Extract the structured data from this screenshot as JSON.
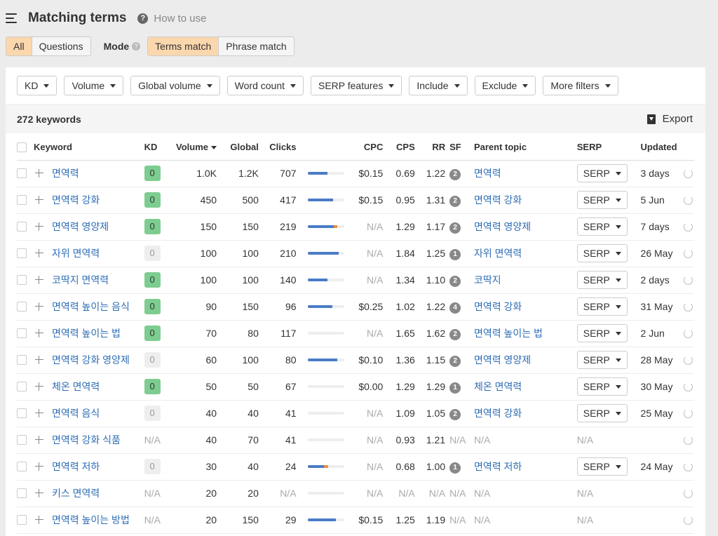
{
  "header": {
    "title": "Matching terms",
    "help_label": "How to use",
    "menu_icon": "hamburger-menu-icon"
  },
  "tabs": {
    "all": "All",
    "questions": "Questions",
    "mode_label": "Mode",
    "terms_match": "Terms match",
    "phrase_match": "Phrase match"
  },
  "filters": [
    "KD",
    "Volume",
    "Global volume",
    "Word count",
    "SERP features",
    "Include",
    "Exclude",
    "More filters"
  ],
  "summary": {
    "count_label": "272 keywords",
    "export_label": "Export"
  },
  "columns": {
    "keyword": "Keyword",
    "kd": "KD",
    "volume": "Volume",
    "global": "Global",
    "clicks": "Clicks",
    "cpc": "CPC",
    "cps": "CPS",
    "rr": "RR",
    "sf": "SF",
    "parent": "Parent topic",
    "serp": "SERP",
    "updated": "Updated"
  },
  "serp_button": "SERP",
  "colors": {
    "accent": "#fbd7ad",
    "link": "#2e6db4",
    "kd_green": "#7ccd8f",
    "bar_blue": "#4a7cc7",
    "bar_orange": "#e8903e"
  },
  "rows": [
    {
      "keyword": "면역력",
      "kd": "0",
      "kd_color": "green",
      "volume": "1.0K",
      "global": "1.2K",
      "clicks": "707",
      "bar_blue": 0.55,
      "bar_orange": 0,
      "cpc": "$0.15",
      "cps": "0.69",
      "rr": "1.22",
      "sf": "2",
      "parent": "면역력",
      "serp": true,
      "updated": "3 days"
    },
    {
      "keyword": "면역력 강화",
      "kd": "0",
      "kd_color": "green",
      "volume": "450",
      "global": "500",
      "clicks": "417",
      "bar_blue": 0.7,
      "bar_orange": 0,
      "cpc": "$0.15",
      "cps": "0.95",
      "rr": "1.31",
      "sf": "2",
      "parent": "면역력 강화",
      "serp": true,
      "updated": "5 Jun"
    },
    {
      "keyword": "면역력 영양제",
      "kd": "0",
      "kd_color": "green",
      "volume": "150",
      "global": "150",
      "clicks": "219",
      "bar_blue": 0.72,
      "bar_orange": 0.1,
      "cpc": "N/A",
      "cps": "1.29",
      "rr": "1.17",
      "sf": "2",
      "parent": "면역력 영양제",
      "serp": true,
      "updated": "7 days"
    },
    {
      "keyword": "자위 면역력",
      "kd": "0",
      "kd_color": "gray",
      "volume": "100",
      "global": "100",
      "clicks": "210",
      "bar_blue": 0.85,
      "bar_orange": 0,
      "cpc": "N/A",
      "cps": "1.84",
      "rr": "1.25",
      "sf": "1",
      "parent": "자위 면역력",
      "serp": true,
      "updated": "26 May"
    },
    {
      "keyword": "코딱지 면역력",
      "kd": "0",
      "kd_color": "green",
      "volume": "100",
      "global": "100",
      "clicks": "140",
      "bar_blue": 0.55,
      "bar_orange": 0,
      "cpc": "N/A",
      "cps": "1.34",
      "rr": "1.10",
      "sf": "2",
      "parent": "코딱지",
      "serp": true,
      "updated": "2 days"
    },
    {
      "keyword": "면역력 높이는 음식",
      "kd": "0",
      "kd_color": "green",
      "volume": "90",
      "global": "150",
      "clicks": "96",
      "bar_blue": 0.68,
      "bar_orange": 0,
      "cpc": "$0.25",
      "cps": "1.02",
      "rr": "1.22",
      "sf": "4",
      "parent": "면역력 강화",
      "serp": true,
      "updated": "31 May"
    },
    {
      "keyword": "면역력 높이는 법",
      "kd": "0",
      "kd_color": "green",
      "volume": "70",
      "global": "80",
      "clicks": "117",
      "bar_blue": 0,
      "bar_orange": 0,
      "cpc": "N/A",
      "cps": "1.65",
      "rr": "1.62",
      "sf": "2",
      "parent": "면역력 높이는 법",
      "serp": true,
      "updated": "2 Jun"
    },
    {
      "keyword": "면역력 강화 영양제",
      "kd": "0",
      "kd_color": "gray",
      "volume": "60",
      "global": "100",
      "clicks": "80",
      "bar_blue": 0.82,
      "bar_orange": 0,
      "cpc": "$0.10",
      "cps": "1.36",
      "rr": "1.15",
      "sf": "2",
      "parent": "면역력 영양제",
      "serp": true,
      "updated": "28 May"
    },
    {
      "keyword": "체온 면역력",
      "kd": "0",
      "kd_color": "green",
      "volume": "50",
      "global": "50",
      "clicks": "67",
      "bar_blue": 0,
      "bar_orange": 0,
      "cpc": "$0.00",
      "cps": "1.29",
      "rr": "1.29",
      "sf": "1",
      "parent": "체온 면역력",
      "serp": true,
      "updated": "30 May"
    },
    {
      "keyword": "면역력 음식",
      "kd": "0",
      "kd_color": "gray",
      "volume": "40",
      "global": "40",
      "clicks": "41",
      "bar_blue": 0,
      "bar_orange": 0,
      "cpc": "N/A",
      "cps": "1.09",
      "rr": "1.05",
      "sf": "2",
      "parent": "면역력 강화",
      "serp": true,
      "updated": "25 May"
    },
    {
      "keyword": "면역력 강화 식품",
      "kd": "N/A",
      "kd_color": "na",
      "volume": "40",
      "global": "70",
      "clicks": "41",
      "bar_blue": 0,
      "bar_orange": 0,
      "cpc": "N/A",
      "cps": "0.93",
      "rr": "1.21",
      "sf": "N/A",
      "parent": "N/A",
      "serp": false,
      "serp_na": "N/A",
      "updated": ""
    },
    {
      "keyword": "면역력 저하",
      "kd": "0",
      "kd_color": "gray",
      "volume": "30",
      "global": "40",
      "clicks": "24",
      "bar_blue": 0.45,
      "bar_orange": 0.12,
      "cpc": "N/A",
      "cps": "0.68",
      "rr": "1.00",
      "sf": "1",
      "parent": "면역력 저하",
      "serp": true,
      "updated": "24 May"
    },
    {
      "keyword": "키스 면역력",
      "kd": "N/A",
      "kd_color": "na",
      "volume": "20",
      "global": "20",
      "clicks": "N/A",
      "bar_blue": 0,
      "bar_orange": 0,
      "cpc": "N/A",
      "cps": "N/A",
      "rr": "N/A",
      "sf": "N/A",
      "parent": "N/A",
      "serp": false,
      "serp_na": "N/A",
      "updated": ""
    },
    {
      "keyword": "면역력 높이는 방법",
      "kd": "N/A",
      "kd_color": "na",
      "volume": "20",
      "global": "150",
      "clicks": "29",
      "bar_blue": 0.78,
      "bar_orange": 0,
      "cpc": "$0.15",
      "cps": "1.25",
      "rr": "1.19",
      "sf": "N/A",
      "parent": "N/A",
      "serp": false,
      "serp_na": "N/A",
      "updated": ""
    }
  ]
}
